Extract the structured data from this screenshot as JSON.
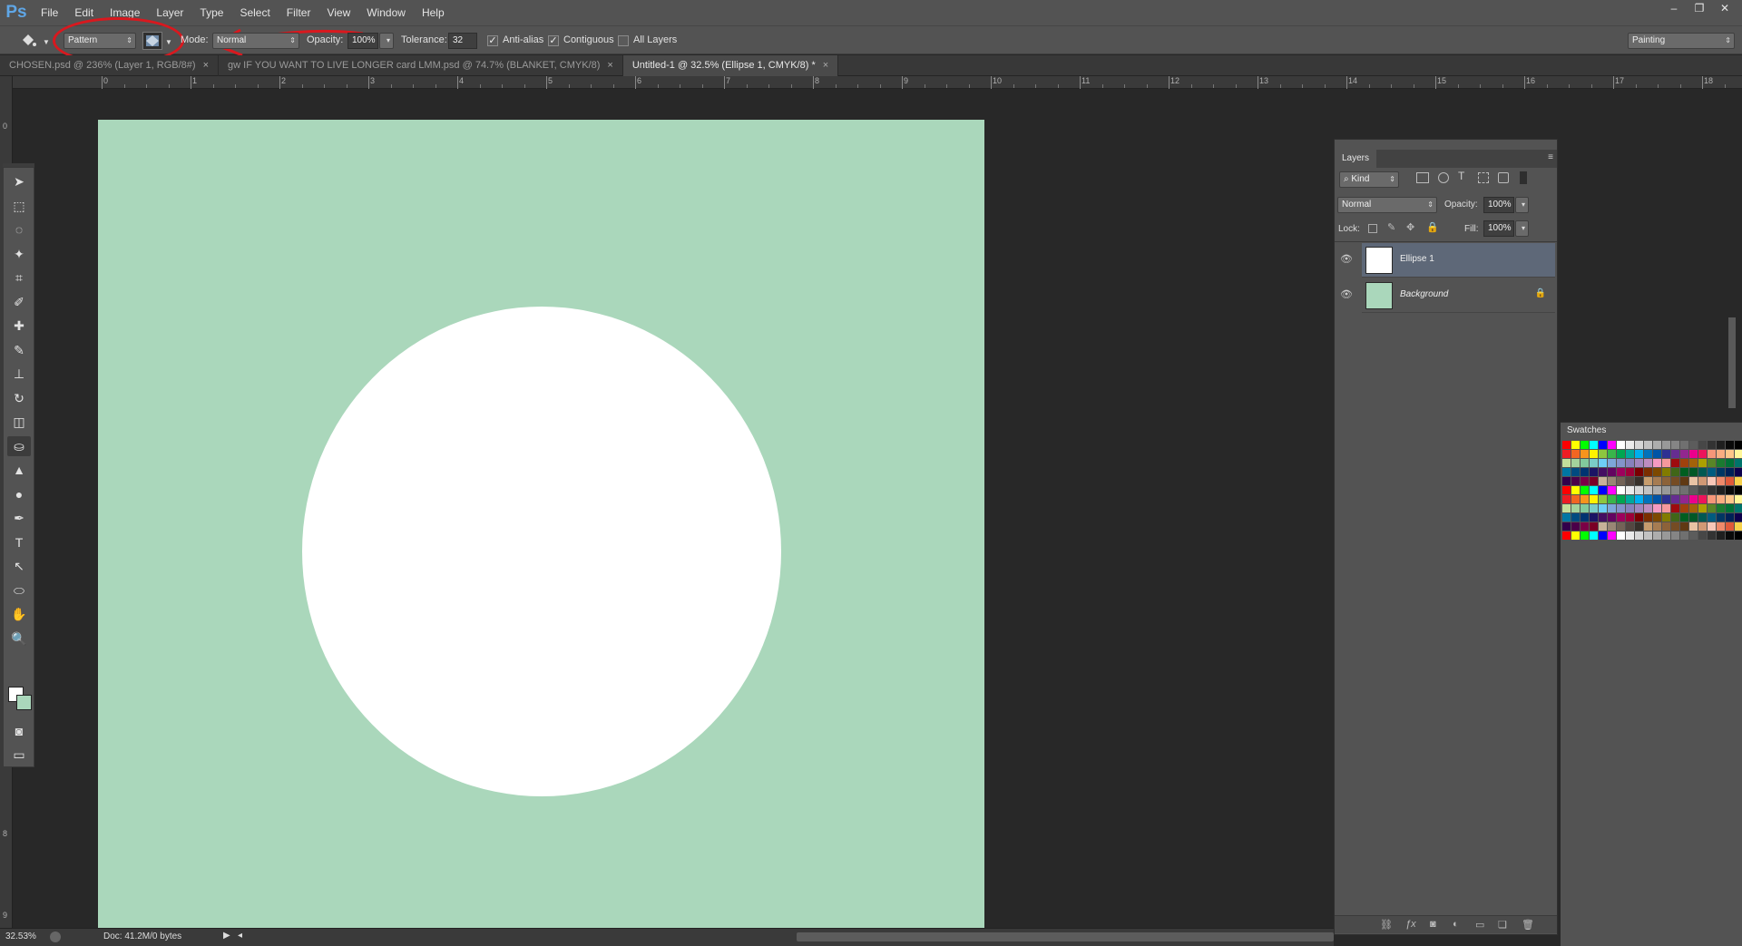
{
  "app": {
    "logo": "Ps"
  },
  "menu": [
    "File",
    "Edit",
    "Image",
    "Layer",
    "Type",
    "Select",
    "Filter",
    "View",
    "Window",
    "Help"
  ],
  "window_controls": [
    "–",
    "❐",
    "✕"
  ],
  "options": {
    "tool_icon": "paint-bucket-icon",
    "fill_source": "Pattern",
    "mode_label": "Mode:",
    "mode_value": "Normal",
    "opacity_label": "Opacity:",
    "opacity_value": "100%",
    "tolerance_label": "Tolerance:",
    "tolerance_value": "32",
    "anti_alias_label": "Anti-alias",
    "contiguous_label": "Contiguous",
    "all_layers_label": "All Layers",
    "workspace": "Painting"
  },
  "tabs": [
    {
      "label": "CHOSEN.psd @ 236% (Layer 1, RGB/8#)",
      "close": "×"
    },
    {
      "label": "gw IF YOU WANT TO LIVE LONGER card LMM.psd @ 74.7% (BLANKET, CMYK/8)",
      "close": "×"
    },
    {
      "label": "Untitled-1 @ 32.5% (Ellipse 1, CMYK/8) *",
      "close": "×"
    }
  ],
  "ruler_labels": [
    "0",
    "1",
    "2",
    "3",
    "4",
    "5",
    "6",
    "7",
    "8",
    "9",
    "10",
    "11",
    "12",
    "13",
    "14",
    "15",
    "16",
    "17",
    "18"
  ],
  "vertical_ruler_labels": [
    "0",
    "8",
    "9"
  ],
  "tools": [
    "move-icon",
    "marquee-icon",
    "lasso-icon",
    "quick-select-icon",
    "crop-icon",
    "eyedropper-icon",
    "healing-icon",
    "brush-icon",
    "stamp-icon",
    "history-brush-icon",
    "eraser-icon",
    "paint-bucket-icon",
    "blur-icon",
    "dodge-icon",
    "pen-icon",
    "type-icon",
    "path-select-icon",
    "ellipse-icon",
    "hand-icon",
    "zoom-icon"
  ],
  "layers_panel": {
    "title": "Layers",
    "kind_label": "Kind",
    "blend_mode": "Normal",
    "opacity_label": "Opacity:",
    "opacity_value": "100%",
    "lock_label": "Lock:",
    "fill_label": "Fill:",
    "fill_value": "100%",
    "layers": [
      {
        "name": "Ellipse 1",
        "selected": true,
        "thumb_color": "#ffffff"
      },
      {
        "name": "Background",
        "selected": false,
        "thumb_color": "#aad7bb"
      }
    ]
  },
  "swatches_panel": {
    "title": "Swatches",
    "colors": [
      "#ff0000",
      "#ffff00",
      "#00ff00",
      "#00ffff",
      "#0000ff",
      "#ff00ff",
      "#ffffff",
      "#ebebeb",
      "#d6d6d6",
      "#c2c2c2",
      "#adadad",
      "#999999",
      "#858585",
      "#707070",
      "#5c5c5c",
      "#474747",
      "#333333",
      "#1f1f1f",
      "#0a0a0a",
      "#000000",
      "#ed1c24",
      "#f26522",
      "#f7941d",
      "#fff200",
      "#8dc63f",
      "#39b54a",
      "#00a651",
      "#00a99d",
      "#00aeef",
      "#0072bc",
      "#0054a6",
      "#2e3192",
      "#662d91",
      "#92278f",
      "#ec008c",
      "#ed145b",
      "#f69679",
      "#f9ad81",
      "#fdc689",
      "#fff799",
      "#c4df9b",
      "#a3d39c",
      "#82ca9c",
      "#7accc8",
      "#6dcff6",
      "#7da7d9",
      "#8393ca",
      "#8781bd",
      "#a186be",
      "#bd8cbf",
      "#f49ac2",
      "#f5989d",
      "#9e0b0f",
      "#a0410d",
      "#a36209",
      "#aba000",
      "#598527",
      "#1a7b30",
      "#007236",
      "#00746b",
      "#0076a3",
      "#004b80",
      "#003471",
      "#1b1464",
      "#440e62",
      "#630460",
      "#9e005d",
      "#9e0039",
      "#790000",
      "#7b2e00",
      "#7d4900",
      "#827b00",
      "#406618",
      "#005e20",
      "#005826",
      "#005952",
      "#005b7f",
      "#003663",
      "#002157",
      "#0d004c",
      "#32004b",
      "#4b0049",
      "#7b0046",
      "#7a0026",
      "#c7b299",
      "#998675",
      "#736357",
      "#534741",
      "#37302a",
      "#c69c6d",
      "#a67c52",
      "#8c6239",
      "#754c24",
      "#603913",
      "#e8c3a4",
      "#d19975",
      "#f8c7b8",
      "#ef8a6b",
      "#e05a3a",
      "#f7d14a"
    ],
    "extra_rows": 6
  },
  "status": {
    "zoom": "32.53%",
    "doc_info": "Doc: 41.2M/0 bytes"
  }
}
